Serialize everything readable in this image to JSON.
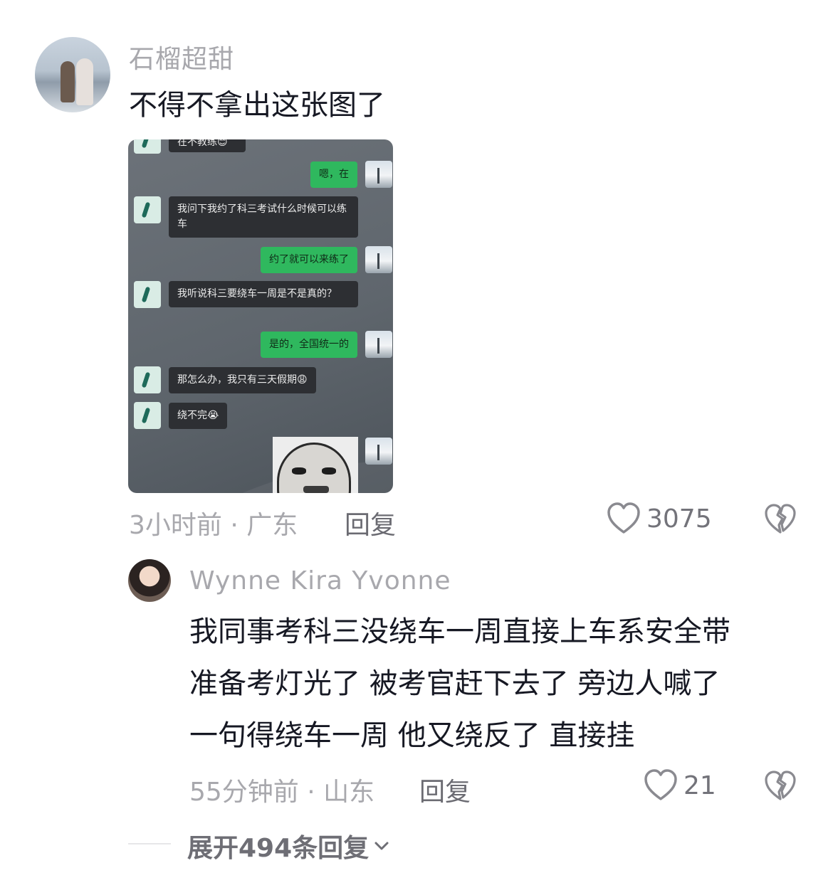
{
  "comment": {
    "username": "石榴超甜",
    "text": "不得不拿出这张图了",
    "image": {
      "messages": [
        {
          "side": "left",
          "text": "在不教练😊"
        },
        {
          "side": "right",
          "text": "嗯，在"
        },
        {
          "side": "left",
          "text": "我问下我约了科三考试什么时候可以练车"
        },
        {
          "side": "right",
          "text": "约了就可以来练了"
        },
        {
          "side": "left",
          "text": "我听说科三要绕车一周是不是真的？"
        },
        {
          "side": "right",
          "text": "是的，全国统一的"
        },
        {
          "side": "left",
          "text": "那怎么办，我只有三天假期😩"
        },
        {
          "side": "left",
          "text": "绕不完😭"
        }
      ]
    },
    "time_location": "3小时前 · 广东",
    "reply_label": "回复",
    "like_icon": "heart-outline-icon",
    "like_count": "3075",
    "dislike_icon": "broken-heart-icon"
  },
  "reply": {
    "username": "Wynne Kira Yvonne",
    "text_lines": [
      "我同事考科三没绕车一周直接上车系安全带",
      "准备考灯光了 被考官赶下去了 旁边人喊了",
      "一句得绕车一周 他又绕反了 直接挂"
    ],
    "time_location": "55分钟前 · 山东",
    "reply_label": "回复",
    "like_count": "21"
  },
  "expand": {
    "label": "展开494条回复",
    "icon": "chevron-down-icon"
  },
  "colors": {
    "muted": "#a8a8ad",
    "text": "#161823",
    "wechat_green": "#2fb85e"
  }
}
